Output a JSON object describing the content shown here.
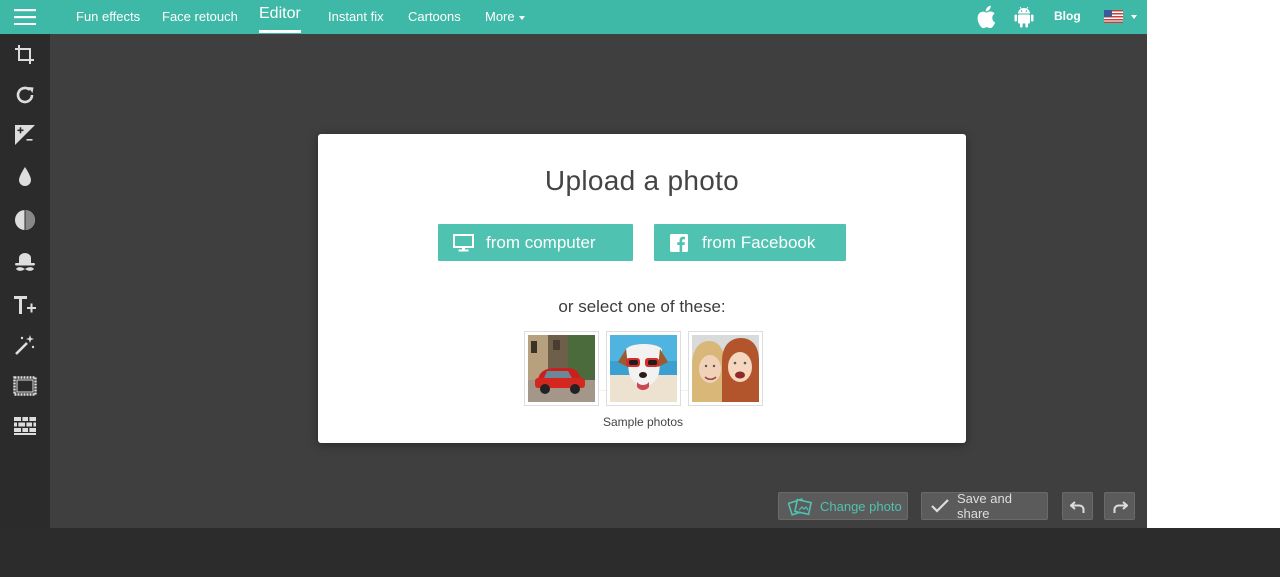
{
  "nav": {
    "items": [
      {
        "label": "Fun effects"
      },
      {
        "label": "Face retouch"
      },
      {
        "label": "Editor",
        "active": true
      },
      {
        "label": "Instant fix"
      },
      {
        "label": "Cartoons"
      },
      {
        "label": "More"
      }
    ],
    "blog": "Blog"
  },
  "icons": {
    "menu": "hamburger-menu-icon",
    "apple": "apple-icon",
    "android": "android-icon",
    "flag": "us-flag-icon",
    "tools": [
      "crop-icon",
      "rotate-icon",
      "exposure-icon",
      "color-drop-icon",
      "contrast-icon",
      "mustache-hat-icon",
      "text-add-icon",
      "magic-wand-icon",
      "frame-icon",
      "texture-icon"
    ]
  },
  "dialog": {
    "title": "Upload a photo",
    "from_computer": "from computer",
    "from_facebook": "from Facebook",
    "or_select": "or select one of these:",
    "samples_caption": "Sample photos"
  },
  "actions": {
    "change_photo": "Change photo",
    "save_share": "Save and share"
  },
  "colors": {
    "accent": "#3fb9a7",
    "button": "#4fc2b1",
    "sidebar": "#2b2b2b",
    "canvas": "#3f3f3f"
  }
}
